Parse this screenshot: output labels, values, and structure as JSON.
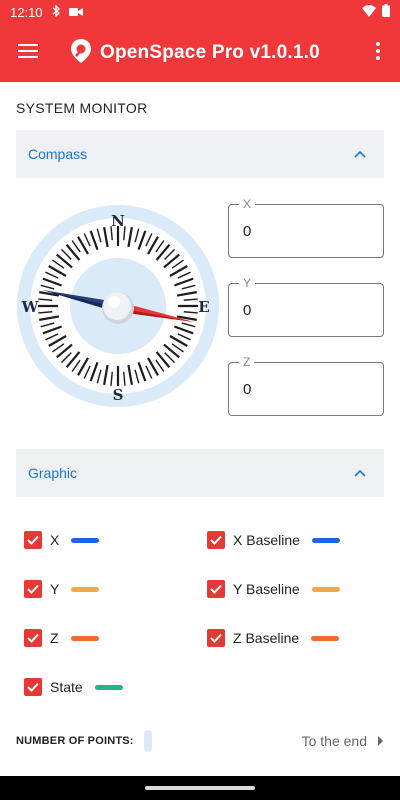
{
  "status": {
    "time": "12:10"
  },
  "app": {
    "title": "OpenSpace Pro v1.0.1.0"
  },
  "section_title": "SYSTEM MONITOR",
  "compass_panel": {
    "title": "Compass",
    "directions": {
      "n": "N",
      "s": "S",
      "e": "E",
      "w": "W"
    }
  },
  "fields": {
    "x": {
      "label": "X",
      "value": "0"
    },
    "y": {
      "label": "Y",
      "value": "0"
    },
    "z": {
      "label": "Z",
      "value": "0"
    }
  },
  "graphic_panel": {
    "title": "Graphic",
    "series": [
      {
        "label": "X",
        "checked": true,
        "color": "#1e63e9"
      },
      {
        "label": "X Baseline",
        "checked": true,
        "color": "#1e63e9"
      },
      {
        "label": "Y",
        "checked": true,
        "color": "#f5a54a"
      },
      {
        "label": "Y Baseline",
        "checked": true,
        "color": "#f5a54a"
      },
      {
        "label": "Z",
        "checked": true,
        "color": "#f06a35"
      },
      {
        "label": "Z Baseline",
        "checked": true,
        "color": "#f06a35"
      },
      {
        "label": "State",
        "checked": true,
        "color": "#1db58a"
      }
    ]
  },
  "points": {
    "label": "NUMBER OF POINTS:",
    "end_label": "To the end"
  },
  "colors": {
    "accent": "#f0383b",
    "link": "#1976d2",
    "checkbox": "#e53935"
  }
}
